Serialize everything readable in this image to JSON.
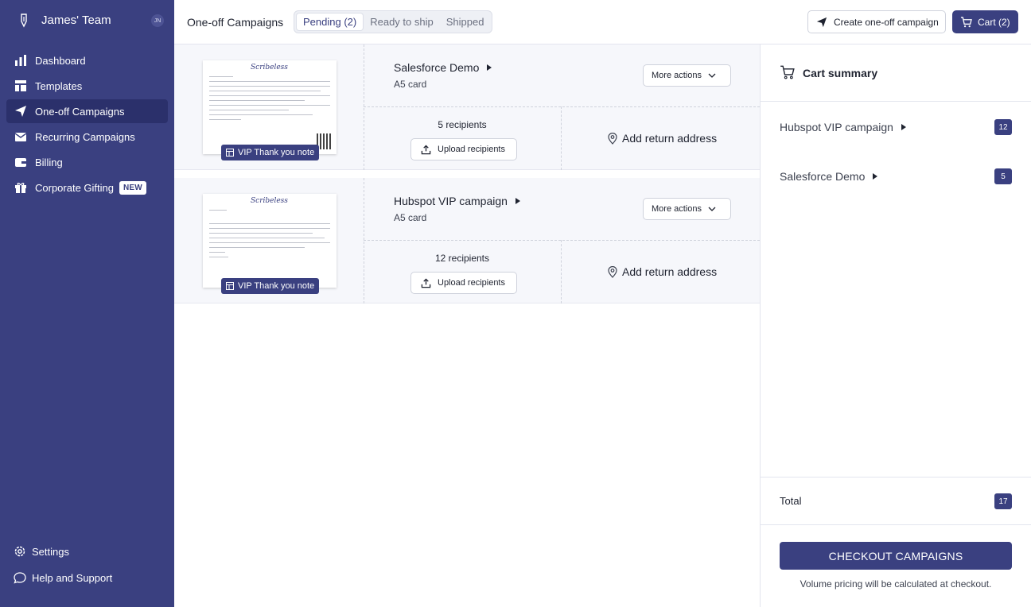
{
  "sidebar": {
    "team_name": "James' Team",
    "avatar_initials": "JN",
    "items": [
      {
        "label": "Dashboard",
        "icon": "bar-chart-icon"
      },
      {
        "label": "Templates",
        "icon": "template-icon"
      },
      {
        "label": "One-off Campaigns",
        "icon": "send-icon",
        "active": true
      },
      {
        "label": "Recurring Campaigns",
        "icon": "mail-icon"
      },
      {
        "label": "Billing",
        "icon": "wallet-icon"
      },
      {
        "label": "Corporate Gifting",
        "icon": "gift-icon",
        "badge": "NEW"
      }
    ],
    "footer": [
      {
        "label": "Settings",
        "icon": "gear-icon"
      },
      {
        "label": "Help and Support",
        "icon": "chat-bubble-icon"
      }
    ],
    "colors": {
      "background": "#3a4080",
      "active": "#2b306b"
    }
  },
  "header": {
    "title": "One-off Campaigns",
    "tabs": [
      {
        "label": "Pending (2)",
        "active": true
      },
      {
        "label": "Ready to ship"
      },
      {
        "label": "Shipped"
      }
    ],
    "create_label": "Create one-off campaign",
    "cart_label": "Cart (2)"
  },
  "campaigns": [
    {
      "name": "Salesforce Demo",
      "type": "A5 card",
      "tag": "VIP Thank you note",
      "more_label": "More actions",
      "recipients": "5 recipients",
      "upload_label": "Upload recipients",
      "address_label": "Add return address",
      "thumb_brand": "Scribeless"
    },
    {
      "name": "Hubspot VIP campaign",
      "type": "A5 card",
      "tag": "VIP Thank you note",
      "more_label": "More actions",
      "recipients": "12 recipients",
      "upload_label": "Upload recipients",
      "address_label": "Add return address",
      "thumb_brand": "Scribeless"
    }
  ],
  "cart": {
    "title": "Cart summary",
    "items": [
      {
        "name": "Hubspot VIP campaign",
        "count": "12"
      },
      {
        "name": "Salesforce Demo",
        "count": "5"
      }
    ],
    "total_label": "Total",
    "total_count": "17",
    "checkout_label": "CHECKOUT CAMPAIGNS",
    "note": "Volume pricing will be calculated at checkout."
  },
  "accent_color": "#3a4080"
}
